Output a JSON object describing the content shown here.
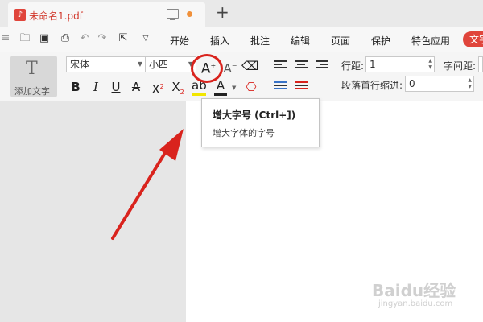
{
  "tab": {
    "title": "未命名1.pdf",
    "pdf_icon": "pdf-file-icon"
  },
  "menubar": {
    "items": [
      "开始",
      "插入",
      "批注",
      "编辑",
      "页面",
      "保护",
      "特色应用",
      "文字"
    ]
  },
  "ribbon": {
    "add_text_label": "添加文字",
    "font_name": "宋体",
    "font_size": "小四",
    "line_spacing_label": "行距:",
    "line_spacing_value": "1",
    "char_spacing_label": "字间距:",
    "first_indent_label": "段落首行缩进:",
    "first_indent_value": "0"
  },
  "tooltip": {
    "title": "增大字号 (Ctrl+])",
    "description": "增大字体的字号"
  },
  "watermark": {
    "main": "Baidu经验",
    "sub": "jingyan.baidu.com"
  },
  "colors": {
    "accent_red": "#e0453b",
    "annotation_red": "#d9231d"
  }
}
